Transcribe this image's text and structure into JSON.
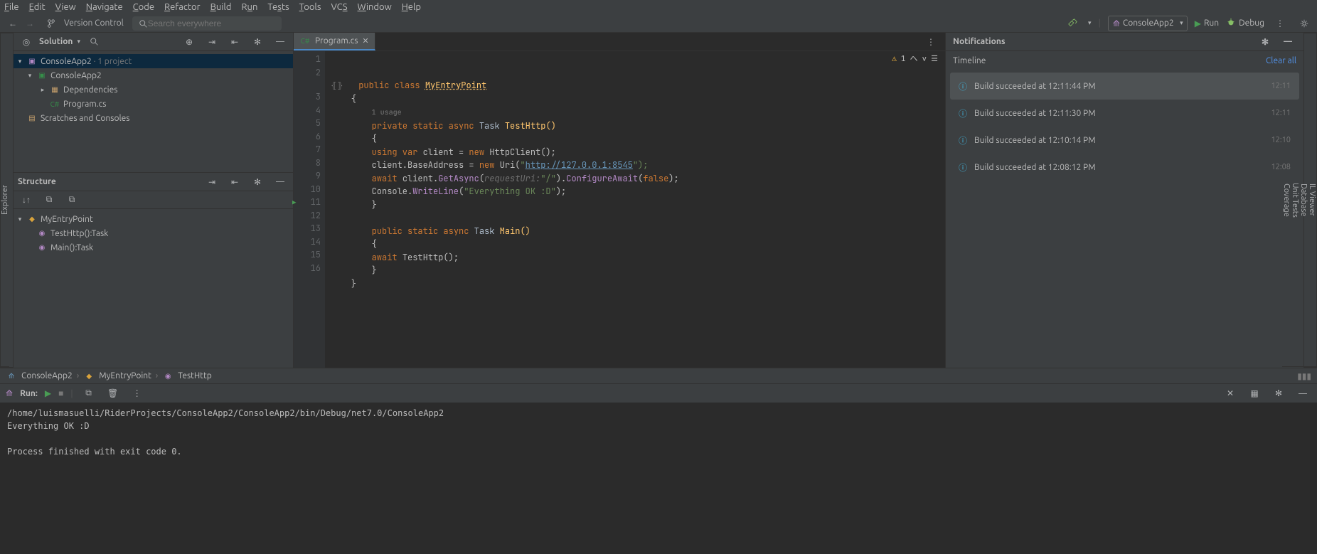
{
  "menu": [
    "File",
    "Edit",
    "View",
    "Navigate",
    "Code",
    "Refactor",
    "Build",
    "Run",
    "Tests",
    "Tools",
    "VCS",
    "Window",
    "Help"
  ],
  "toolbar": {
    "vc": "Version Control",
    "search_placeholder": "Search everywhere",
    "config": "ConsoleApp2",
    "run": "Run",
    "debug": "Debug"
  },
  "solution": {
    "title": "Solution",
    "root": "ConsoleApp2",
    "root_suffix": "· 1 project",
    "project": "ConsoleApp2",
    "dependencies": "Dependencies",
    "program": "Program.cs",
    "scratches": "Scratches and Consoles"
  },
  "structure": {
    "title": "Structure",
    "entry": "MyEntryPoint",
    "test_http": "TestHttp():Task",
    "main": "Main():Task"
  },
  "tab": {
    "name": "Program.cs"
  },
  "code": {
    "usage": "1 usage",
    "warn_count": "1",
    "l1": {
      "a": "public class ",
      "b": "MyEntryPoint"
    },
    "l3": {
      "a": "    private static async ",
      "b": "Task",
      "c": " TestHttp()"
    },
    "l5": {
      "a": "        using var ",
      "b": "client = ",
      "c": "new ",
      "d": "HttpClient();"
    },
    "l6": {
      "a": "        client.BaseAddress = ",
      "b": "new ",
      "c": "Uri(",
      "d": "\"",
      "e": "http://127.0.0.1:8545",
      "f": "\");"
    },
    "l7": {
      "a": "        await ",
      "b": "client.",
      "c": "GetAsync",
      "d": "(",
      "e": "requestUri:",
      "f": "\"/\"",
      "g": ").",
      "h": "ConfigureAwait",
      "i": "(",
      "j": "false",
      "k": ");"
    },
    "l8": {
      "a": "        Console.",
      "b": "WriteLine",
      "c": "(",
      "d": "\"Everything OK :D\"",
      "e": ");"
    },
    "l11": {
      "a": "    public static async ",
      "b": "Task",
      "c": " Main()"
    },
    "l13": {
      "a": "        await ",
      "b": "TestHttp();"
    }
  },
  "breadcrumb": {
    "a": "ConsoleApp2",
    "b": "MyEntryPoint",
    "c": "TestHttp"
  },
  "notifications": {
    "title": "Notifications",
    "timeline": "Timeline",
    "clear": "Clear all",
    "items": [
      {
        "msg": "Build succeeded at 12:11:44 PM",
        "t": "12:11"
      },
      {
        "msg": "Build succeeded at 12:11:30 PM",
        "t": "12:11"
      },
      {
        "msg": "Build succeeded at 12:10:14 PM",
        "t": "12:10"
      },
      {
        "msg": "Build succeeded at 12:08:12 PM",
        "t": "12:08"
      }
    ]
  },
  "side_left": {
    "explorer": "Explorer"
  },
  "side_right": {
    "il": "IL Viewer",
    "db": "Database",
    "ut": "Unit Tests",
    "cov": "Coverage"
  },
  "run": {
    "title": "Run:",
    "out1": "/home/luismasuelli/RiderProjects/ConsoleApp2/ConsoleApp2/bin/Debug/net7.0/ConsoleApp2",
    "out2": "Everything OK :D",
    "out3": "",
    "out4": "Process finished with exit code 0."
  }
}
